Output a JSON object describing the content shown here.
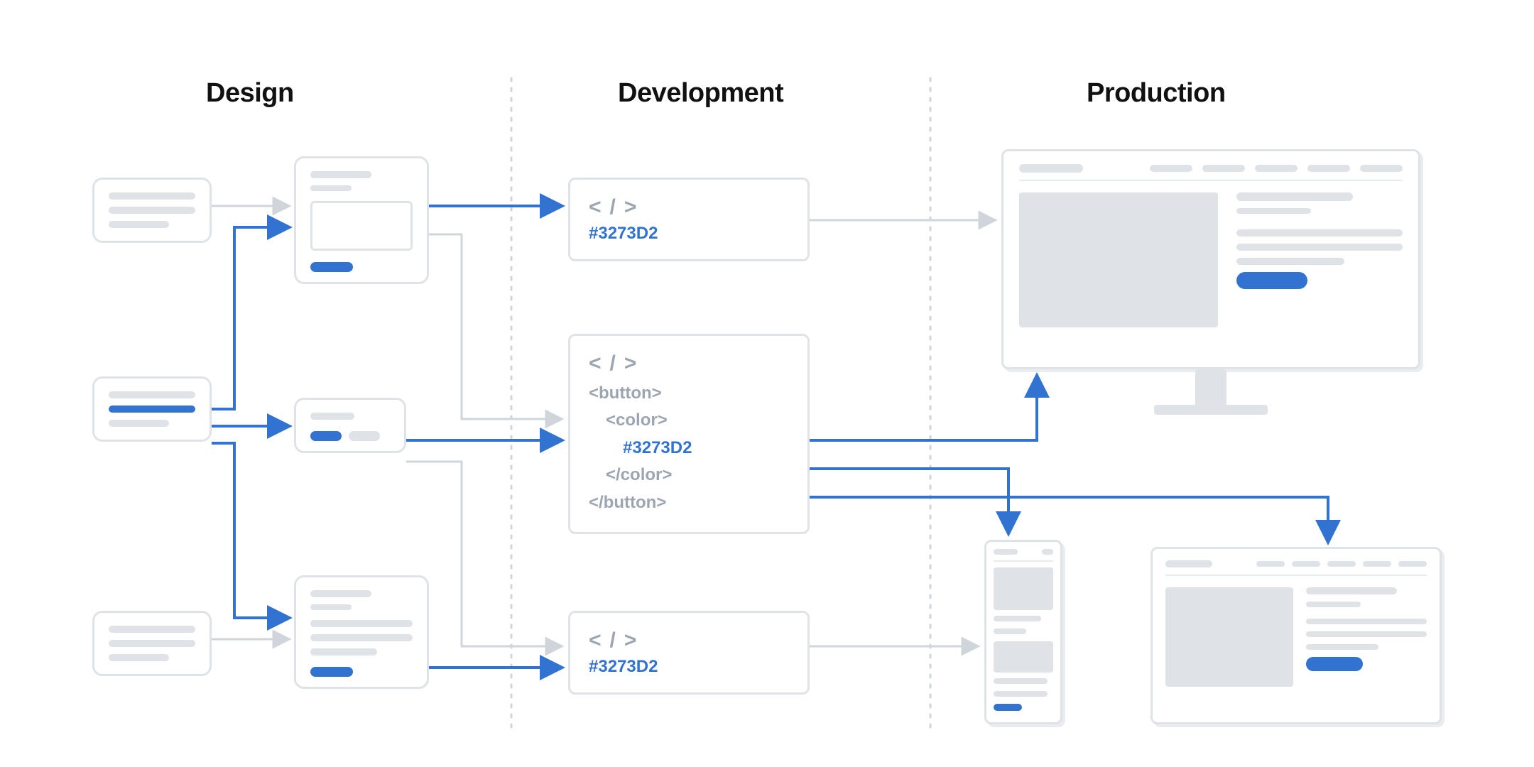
{
  "columns": {
    "design": {
      "heading": "Design"
    },
    "development": {
      "heading": "Development"
    },
    "production": {
      "heading": "Production"
    }
  },
  "accent_color": "#3273D2",
  "development": {
    "code_icon": "< / >",
    "card_top": {
      "hex": "#3273D2"
    },
    "card_middle": {
      "lines": {
        "l1": "<button>",
        "l2": "<color>",
        "l3": "#3273D2",
        "l4": "</color>",
        "l5": "</button>"
      }
    },
    "card_bottom": {
      "hex": "#3273D2"
    }
  }
}
